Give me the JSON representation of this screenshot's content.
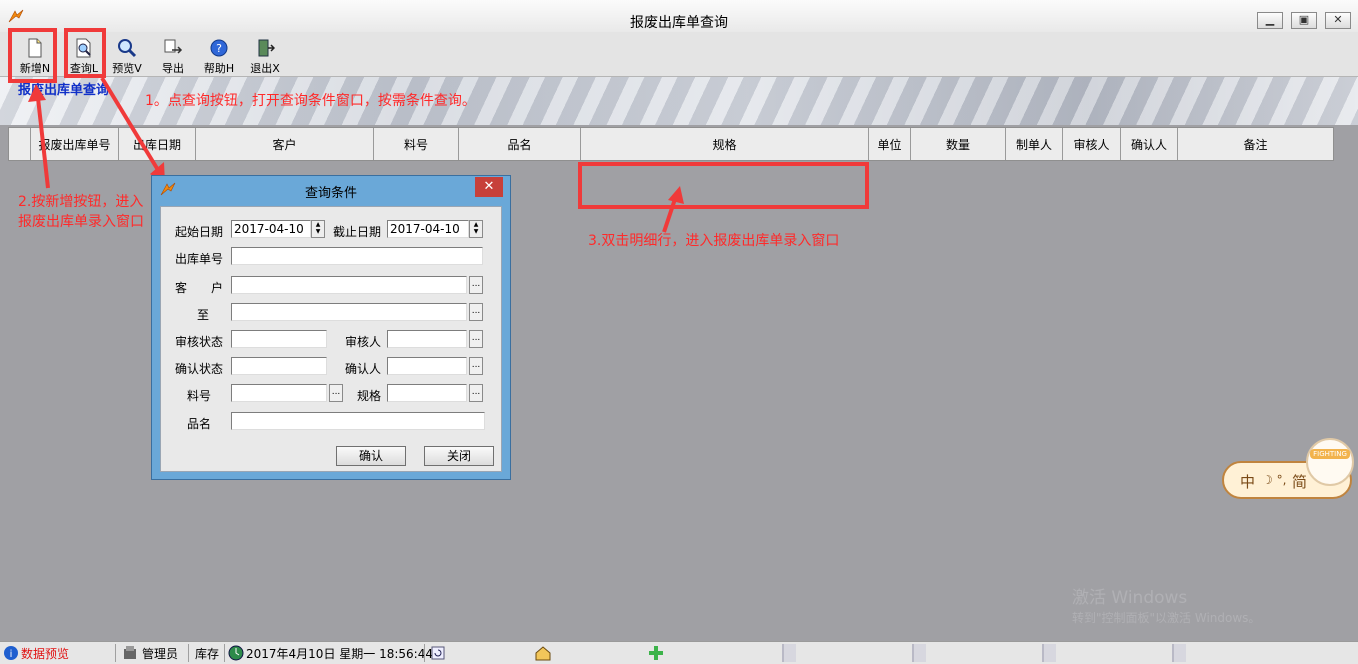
{
  "window": {
    "title": "报废出库单查询"
  },
  "toolbar": [
    {
      "label": "新增N"
    },
    {
      "label": "查询L"
    },
    {
      "label": "预览V"
    },
    {
      "label": "导出"
    },
    {
      "label": "帮助H"
    },
    {
      "label": "退出X"
    }
  ],
  "banner": {
    "title": "报废出库单查询"
  },
  "grid": {
    "columns": [
      "报废出库单号",
      "出库日期",
      "客户",
      "料号",
      "品名",
      "规格",
      "单位",
      "数量",
      "制单人",
      "审核人",
      "确认人",
      "备注"
    ]
  },
  "annotations": {
    "step1": "1。点查询按钮，打开查询条件窗口，按需条件查询。",
    "step2_line1": "2.按新增按钮，进入",
    "step2_line2": "报废出库单录入窗口",
    "step3": "3.双击明细行，进入报废出库单录入窗口"
  },
  "dialog": {
    "title": "查询条件",
    "close": "✕",
    "start_date_label": "起始日期",
    "start_date": "2017-04-10",
    "end_date_label": "截止日期",
    "end_date": "2017-04-10",
    "order_no_label": "出库单号",
    "customer_label": "客　　户",
    "to_label": "至",
    "review_status_label": "审核状态",
    "reviewer_label": "审核人",
    "confirm_status_label": "确认状态",
    "confirmer_label": "确认人",
    "part_no_label": "料号",
    "spec_label": "规格",
    "name_label": "品名",
    "ok": "确认",
    "close_btn": "关闭"
  },
  "ime": {
    "lang": "中",
    "mode": "简",
    "badge": "FIGHTING"
  },
  "watermark": {
    "line1": "激活 Windows",
    "line2": "转到\"控制面板\"以激活 Windows。"
  },
  "status": {
    "preview": "数据预览",
    "user": "管理员",
    "module": "库存",
    "datetime": "2017年4月10日 星期一 18:56:44"
  },
  "colors": {
    "annotation": "#ff2a2a",
    "banner_title": "#1030c8",
    "dialog_frame": "#6aa8d8"
  }
}
